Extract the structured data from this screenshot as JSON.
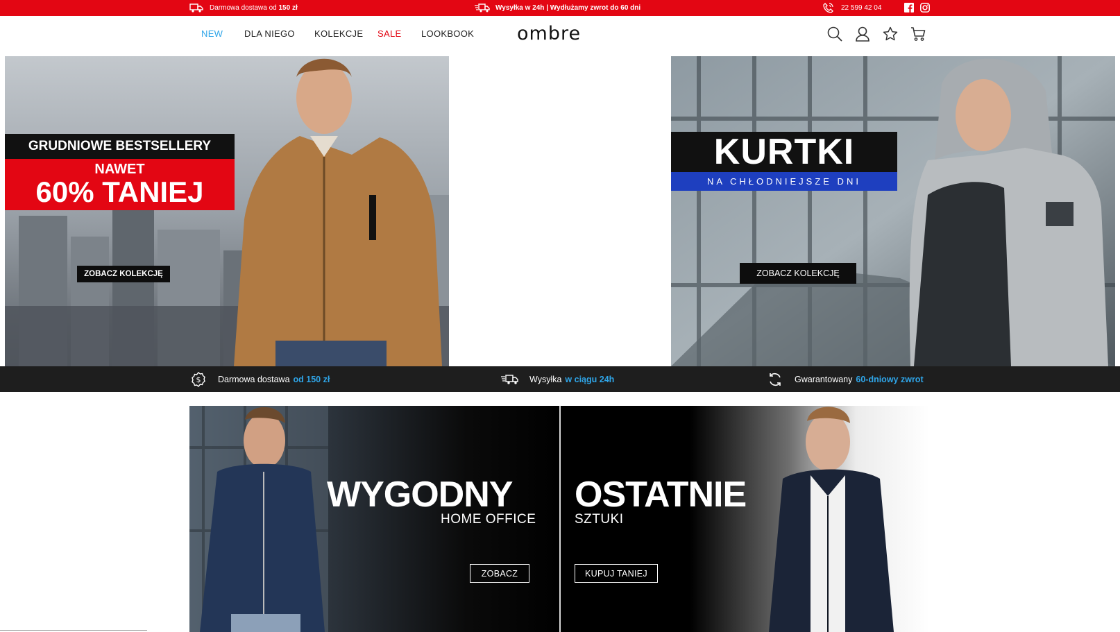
{
  "topbar": {
    "free_delivery_prefix": "Darmowa dostawa od ",
    "free_delivery_amount": "150 zł",
    "shipping_text": "Wysyłka w 24h | Wydłużamy zwrot do 60 dni",
    "phone": "22 599 42 04",
    "icons": [
      "truck-icon",
      "fast-truck-icon",
      "phone-icon",
      "facebook-icon",
      "instagram-icon"
    ],
    "bg_color": "#e30613"
  },
  "nav": {
    "items": [
      {
        "label": "NEW",
        "color": "#2fa5e8"
      },
      {
        "label": "DLA NIEGO",
        "color": "#222222"
      },
      {
        "label": "KOLEKCJE",
        "color": "#222222"
      },
      {
        "label": "SALE",
        "color": "#e30613"
      },
      {
        "label": "LOOKBOOK",
        "color": "#222222"
      }
    ],
    "logo_text": "ombre",
    "icons": [
      "search-icon",
      "user-icon",
      "star-icon",
      "cart-icon"
    ]
  },
  "banner_left": {
    "headline": "GRUDNIOWE BESTSELLERY",
    "subline_1": "NAWET",
    "subline_2": "60% TANIEJ",
    "cta": "ZOBACZ KOLEKCJĘ"
  },
  "banner_right": {
    "headline": "KURTKI",
    "subline": "NA CHŁODNIEJSZE DNI",
    "cta": "ZOBACZ KOLEKCJĘ"
  },
  "benefits": [
    {
      "icon": "coin-badge-icon",
      "text": "Darmowa dostawa",
      "highlight": "od 150 zł"
    },
    {
      "icon": "fast-truck-icon",
      "text": "Wysyłka",
      "highlight": "w ciągu 24h"
    },
    {
      "icon": "return-arrows-icon",
      "text": "Gwarantowany",
      "highlight": "60-dniowy zwrot"
    }
  ],
  "promo": {
    "left_title": "WYGODNY",
    "left_sub": "HOME OFFICE",
    "left_btn": "ZOBACZ",
    "right_title": "OSTATNIE",
    "right_sub": "SZTUKI",
    "right_btn": "KUPUJ TANIEJ"
  },
  "colors": {
    "accent_red": "#e30613",
    "accent_blue": "#2fa5e8",
    "strip_bg": "#1e1e1e"
  }
}
